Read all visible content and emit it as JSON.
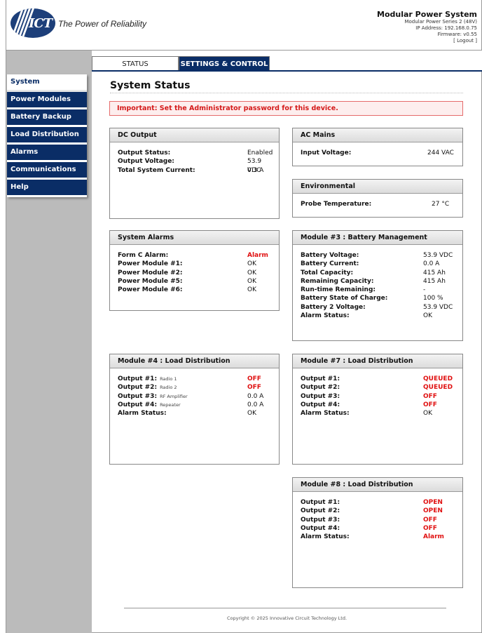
{
  "header": {
    "tagline": "The Power of Reliability",
    "logo_text": "ICT",
    "title": "Modular Power System",
    "series": "Modular Power Series 2 (48V)",
    "ip": "IP Address: 192.168.0.75",
    "firmware": "Firmware: v0.55",
    "logout": "[ Logout ]"
  },
  "tabs": [
    {
      "label": "STATUS"
    },
    {
      "label": "SETTINGS & CONTROL"
    }
  ],
  "sidebar": {
    "items": [
      {
        "label": "System"
      },
      {
        "label": "Power Modules"
      },
      {
        "label": "Battery Backup"
      },
      {
        "label": "Load Distribution"
      },
      {
        "label": "Alarms"
      },
      {
        "label": "Communications"
      },
      {
        "label": "Help"
      }
    ]
  },
  "main": {
    "title": "System Status",
    "warning": "Important: Set the Administrator password for this device."
  },
  "panels": {
    "dc_output": {
      "title": "DC Output",
      "rows": [
        {
          "label": "Output Status:",
          "value": "Enabled"
        },
        {
          "label": "Output Voltage:",
          "value": "53.9 VDC"
        },
        {
          "label": "Total System Current:",
          "value": "0.3 A"
        }
      ]
    },
    "ac_mains": {
      "title": "AC Mains",
      "rows": [
        {
          "label": "Input Voltage:",
          "value": "244 VAC"
        }
      ]
    },
    "environmental": {
      "title": "Environmental",
      "rows": [
        {
          "label": "Probe Temperature:",
          "value": "27 °C"
        }
      ]
    },
    "system_alarms": {
      "title": "System Alarms",
      "rows": [
        {
          "label": "Form C Alarm:",
          "value": "Alarm"
        },
        {
          "label": "Power Module #1:",
          "value": "OK"
        },
        {
          "label": "Power Module #2:",
          "value": "OK"
        },
        {
          "label": "Power Module #5:",
          "value": "OK"
        },
        {
          "label": "Power Module #6:",
          "value": "OK"
        }
      ]
    },
    "module3": {
      "title": "Module #3 : Battery Management",
      "rows": [
        {
          "label": "Battery Voltage:",
          "value": "53.9 VDC"
        },
        {
          "label": "Battery Current:",
          "value": "0.0 A"
        },
        {
          "label": "Total Capacity:",
          "value": "415 Ah"
        },
        {
          "label": "Remaining Capacity:",
          "value": "415 Ah"
        },
        {
          "label": "Run-time Remaining:",
          "value": "-"
        },
        {
          "label": "Battery State of Charge:",
          "value": "100 %"
        },
        {
          "label": "Battery 2 Voltage:",
          "value": "53.9 VDC"
        },
        {
          "label": "Alarm Status:",
          "value": "OK"
        }
      ]
    },
    "module4": {
      "title": "Module #4 : Load Distribution",
      "rows": [
        {
          "label": "Output #1:",
          "sub": "Radio 1",
          "value": "OFF"
        },
        {
          "label": "Output #2:",
          "sub": "Radio 2",
          "value": "OFF"
        },
        {
          "label": "Output #3:",
          "sub": "RF Amplifier",
          "value": "0.0 A"
        },
        {
          "label": "Output #4:",
          "sub": "Repeater",
          "value": "0.0 A"
        },
        {
          "label": "Alarm Status:",
          "sub": "",
          "value": "OK"
        }
      ]
    },
    "module7": {
      "title": "Module #7 : Load Distribution",
      "rows": [
        {
          "label": "Output #1:",
          "value": "QUEUED"
        },
        {
          "label": "Output #2:",
          "value": "QUEUED"
        },
        {
          "label": "Output #3:",
          "value": "OFF"
        },
        {
          "label": "Output #4:",
          "value": "OFF"
        },
        {
          "label": "Alarm Status:",
          "value": "OK"
        }
      ]
    },
    "module8": {
      "title": "Module #8 : Load Distribution",
      "rows": [
        {
          "label": "Output #1:",
          "value": "OPEN"
        },
        {
          "label": "Output #2:",
          "value": "OPEN"
        },
        {
          "label": "Output #3:",
          "value": "OFF"
        },
        {
          "label": "Output #4:",
          "value": "OFF"
        },
        {
          "label": "Alarm Status:",
          "value": "Alarm"
        }
      ]
    }
  },
  "footer": {
    "copyright": "Copyright © 2025 Innovative Circuit Technology Ltd."
  },
  "colors": {
    "nav_blue": "#0a2d66",
    "alert_red": "#e01010",
    "warning_bg": "#fdeeee"
  }
}
